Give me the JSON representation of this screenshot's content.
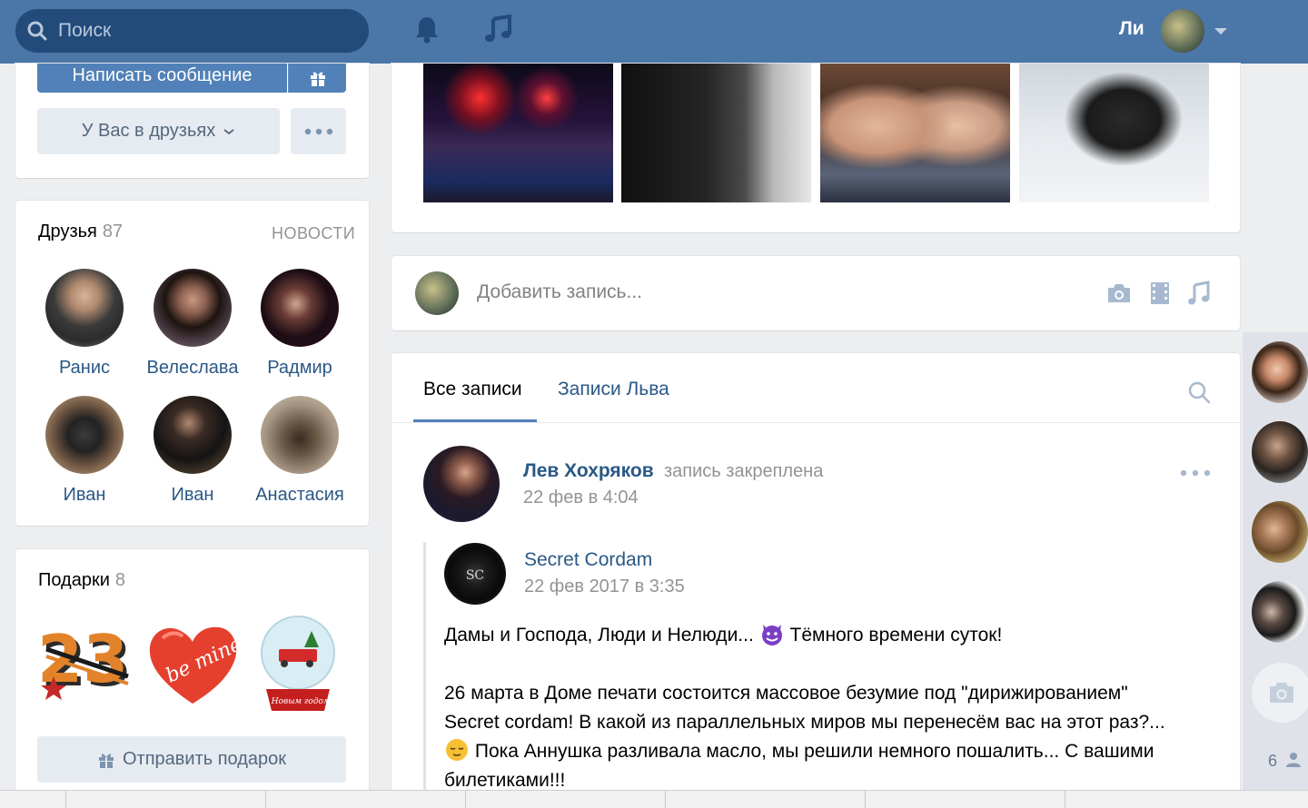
{
  "header": {
    "search_placeholder": "Поиск",
    "user_name": "Ли",
    "accent": "#4a76a8"
  },
  "profile_actions": {
    "write_message": "Написать сообщение",
    "friend_status": "У Вас в друзьях"
  },
  "friends": {
    "title": "Друзья",
    "count": "87",
    "link": "НОВОСТИ",
    "items": [
      {
        "name": "Ранис"
      },
      {
        "name": "Велеслава"
      },
      {
        "name": "Радмир"
      },
      {
        "name": "Иван"
      },
      {
        "name": "Иван"
      },
      {
        "name": "Анастасия"
      }
    ]
  },
  "gifts": {
    "title": "Подарки",
    "count": "8",
    "send_label": "Отправить подарок",
    "items": [
      {
        "icon": "23-february-gift-icon"
      },
      {
        "icon": "heart-be-mine-gift-icon",
        "text": "be mine"
      },
      {
        "icon": "snowglobe-gift-icon",
        "text": "С Новым годом!"
      }
    ]
  },
  "composer": {
    "placeholder": "Добавить запись..."
  },
  "wall": {
    "tabs": [
      {
        "label": "Все записи",
        "active": true
      },
      {
        "label": "Записи Льва",
        "active": false
      }
    ]
  },
  "post": {
    "author": "Лев Хохряков",
    "pinned": "запись закреплена",
    "date": "22 фев в 4:04",
    "repost": {
      "source": "Secret Cordam",
      "date": "22 фев 2017 в 3:35",
      "line1": "Дамы и Господа, Люди и Нелюди...",
      "line1_end": "Тёмного времени суток!",
      "line2": "26 марта в Доме печати состоится массовое безумие под \"дирижированием\"",
      "line3": "Secret cordam! В какой из параллельных миров мы перенесём вас на этот раз?...",
      "line4": "Пока Аннушка разливала масло, мы решили немного пошалить... С вашими",
      "line5": "билетиками!!!"
    }
  },
  "side": {
    "count": "6"
  }
}
